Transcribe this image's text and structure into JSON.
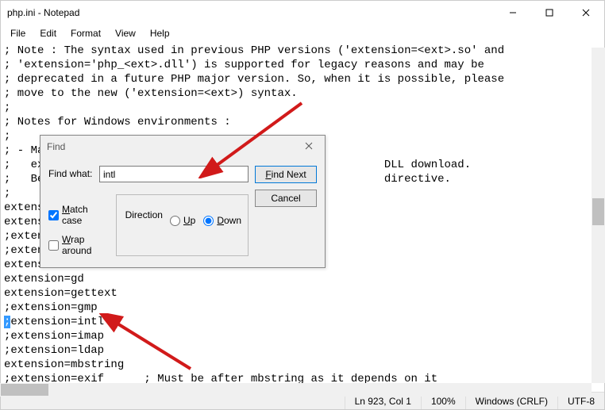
{
  "titlebar": {
    "title": "php.ini - Notepad"
  },
  "menu": {
    "file": "File",
    "edit": "Edit",
    "format": "Format",
    "view": "View",
    "help": "Help"
  },
  "editor": {
    "lines": [
      "; Note : The syntax used in previous PHP versions ('extension=<ext>.so' and",
      "; 'extension='php_<ext>.dll') is supported for legacy reasons and may be",
      "; deprecated in a future PHP major version. So, when it is possible, please",
      "; move to the new ('extension=<ext>) syntax.",
      ";",
      "; Notes for Windows environments :",
      ";",
      "; - Ma",
      ";   ex                                                   DLL download.",
      ";   Be                                                   directive.",
      ";",
      "extensi",
      "extensi",
      ";extens",
      ";extens",
      "extension=fileinfo",
      "extension=gd",
      "extension=gettext",
      ";extension=gmp",
      ";extension=intl",
      ";extension=imap",
      ";extension=ldap",
      "extension=mbstring",
      ";extension=exif      ; Must be after mbstring as it depends on it"
    ],
    "highlight_line_index": 19,
    "highlight_char": ";"
  },
  "find": {
    "title": "Find",
    "find_what_label": "Find what:",
    "value": "intl",
    "find_next": "Find Next",
    "cancel": "Cancel",
    "direction_label": "Direction",
    "up": "Up",
    "down": "Down",
    "match_case": "Match case",
    "wrap_around": "Wrap around",
    "match_case_checked": true,
    "wrap_around_checked": false,
    "direction_value": "down"
  },
  "status": {
    "position": "Ln 923, Col 1",
    "zoom": "100%",
    "line_ending": "Windows (CRLF)",
    "encoding": "UTF-8"
  },
  "annotations": {
    "arrow_color": "#d11a1a"
  }
}
